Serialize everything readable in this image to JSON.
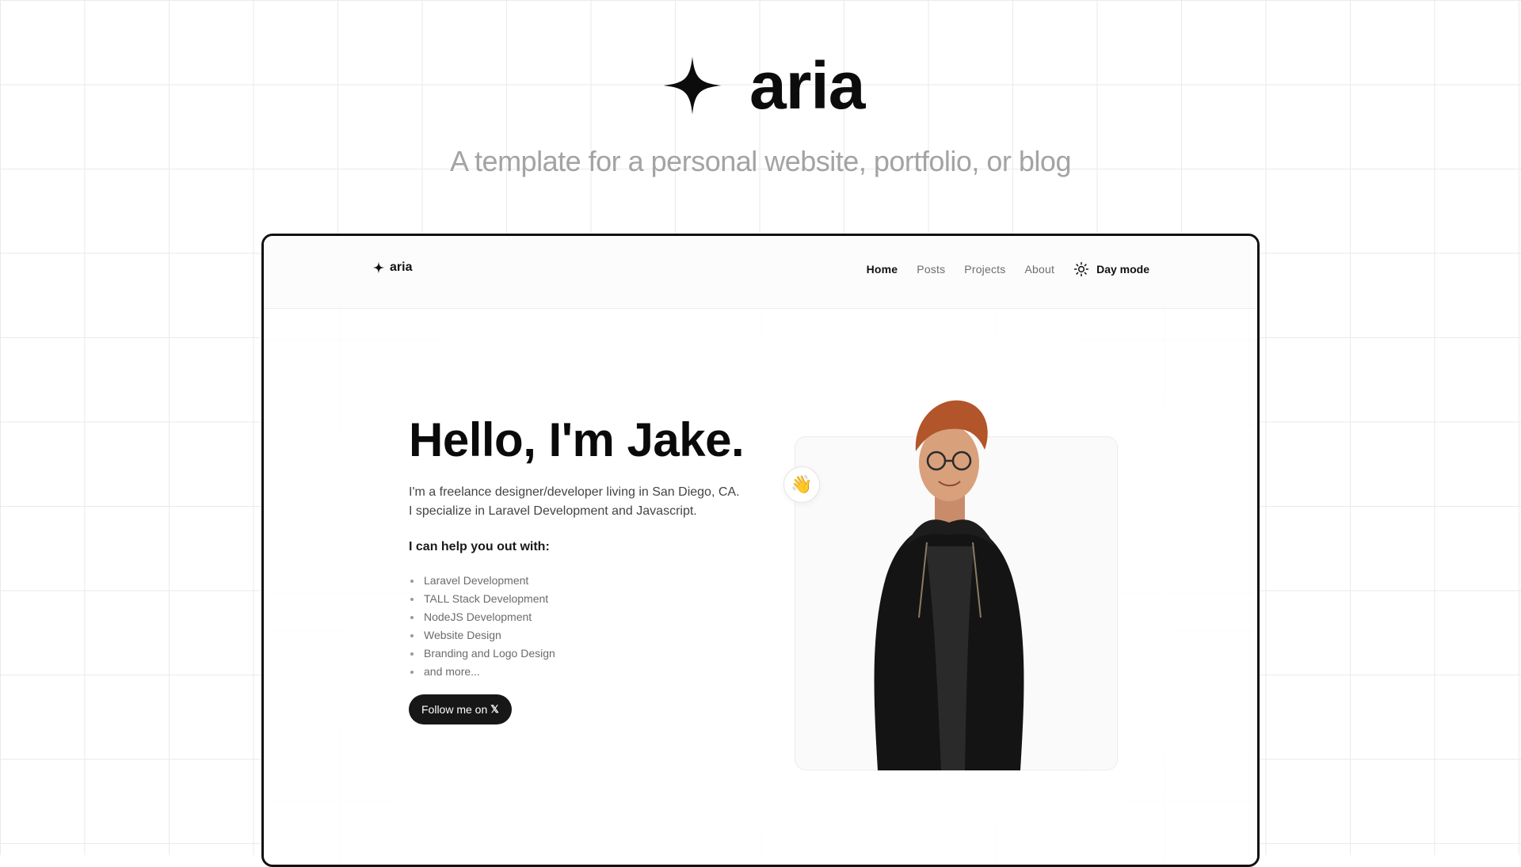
{
  "brand": {
    "name": "aria",
    "tagline": "A template for a personal website, portfolio, or blog",
    "icon": "four-point-star-icon"
  },
  "site": {
    "nav": {
      "logo_text": "aria",
      "links": [
        {
          "label": "Home",
          "active": true
        },
        {
          "label": "Posts",
          "active": false
        },
        {
          "label": "Projects",
          "active": false
        },
        {
          "label": "About",
          "active": false
        }
      ],
      "theme_toggle": {
        "label": "Day mode",
        "icon": "sun-icon"
      }
    },
    "hero": {
      "headline": "Hello, I'm Jake.",
      "intro_line1": "I'm a freelance designer/developer living in San Diego, CA.",
      "intro_line2": "I specialize in Laravel Development and Javascript.",
      "help_title": "I can help you out with:",
      "services": [
        "Laravel Development",
        "TALL Stack Development",
        "NodeJS Development",
        "Website Design",
        "Branding and Logo Design",
        "and more..."
      ],
      "follow_button": {
        "label": "Follow me on",
        "platform_glyph": "𝕏"
      },
      "wave_emoji": "👋",
      "portrait_icon": "portrait-image"
    }
  },
  "colors": {
    "text_primary": "#111111",
    "text_muted": "#6e6e6e",
    "tagline": "#a3a3a3",
    "button_bg": "#171717",
    "grid": "#e7e7e7"
  }
}
